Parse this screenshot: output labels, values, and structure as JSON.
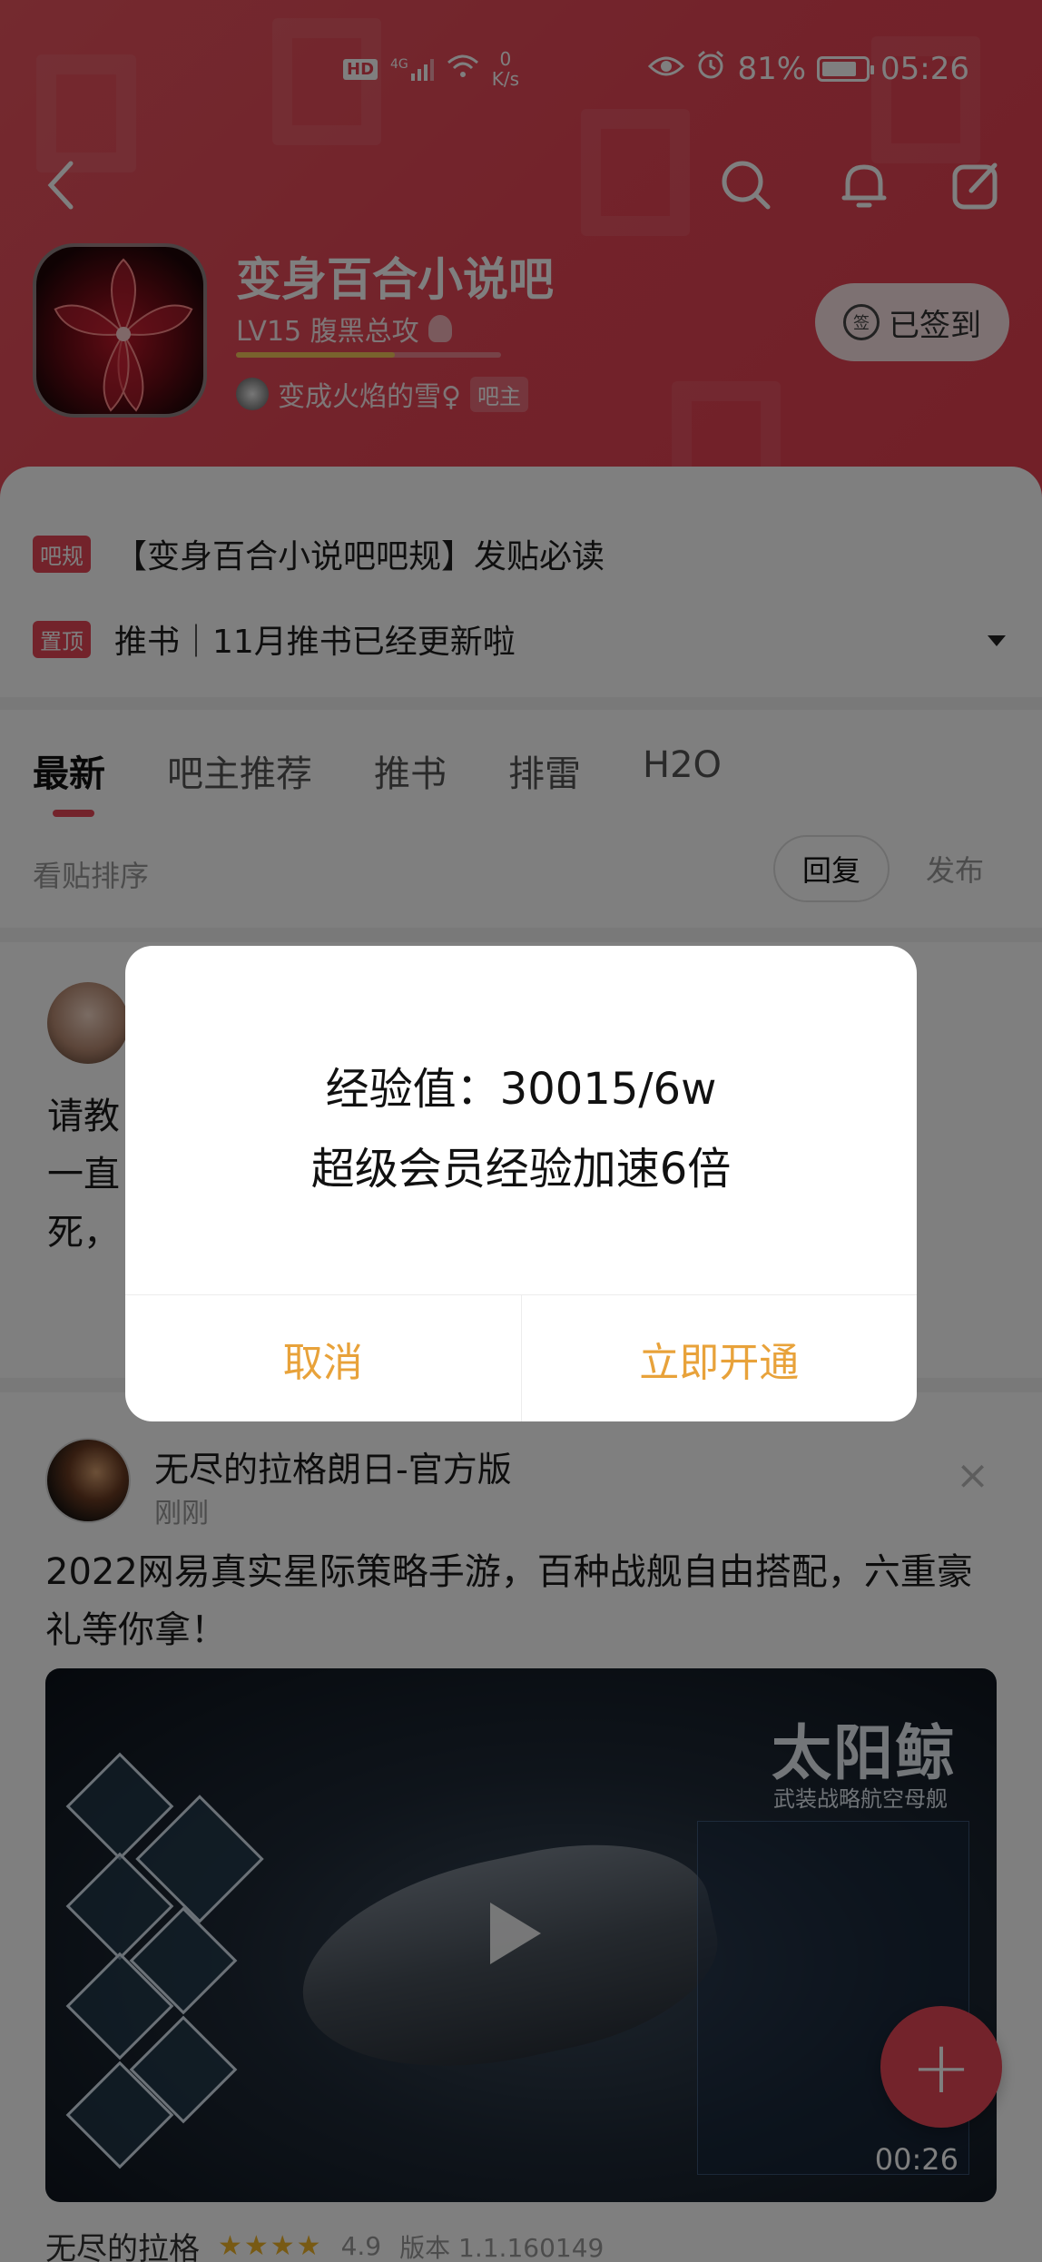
{
  "status_bar": {
    "hd": "HD",
    "network": "4G",
    "speed_value": "0",
    "speed_unit": "K/s",
    "battery": "81%",
    "battery_level": 0.81,
    "time": "05:26"
  },
  "forum": {
    "name": "变身百合小说吧",
    "level": "LV15 腹黑总攻",
    "level_progress": 0.6,
    "owner_name": "变成火焰的雪♀",
    "owner_badge": "吧主",
    "checkin_icon": "签",
    "checkin_label": "已签到"
  },
  "notices": [
    {
      "tag": "吧规",
      "text": "【变身百合小说吧吧规】发贴必读"
    },
    {
      "tag": "置顶",
      "text": "推书｜11月推书已经更新啦"
    }
  ],
  "tabs": [
    "最新",
    "吧主推荐",
    "推书",
    "排雷",
    "H2O"
  ],
  "sort": {
    "label": "看贴排序",
    "reply": "回复",
    "publish": "发布"
  },
  "post1": {
    "text_lines": [
      "请教",
      "一直",
      "死，"
    ]
  },
  "post2": {
    "author": "无尽的拉格朗日-官方版",
    "time": "刚刚",
    "close": "×",
    "text": "2022网易真实星际策略手游，百种战舰自由搭配，六重豪礼等你拿！",
    "video": {
      "title": "太阳鲸",
      "subtitle": "武装战略航空母舰",
      "duration": "00:26"
    },
    "bottom_name": "无尽的拉格",
    "stars": "★★★★",
    "rating": "4.9",
    "version": "版本 1.1.160149"
  },
  "fab": "+",
  "dialog": {
    "line1": "经验值：30015/6w",
    "line2": "超级会员经验加速6倍",
    "cancel": "取消",
    "confirm": "立即开通"
  },
  "colors": {
    "brand": "#e64656",
    "dialog_button": "#e8a23a"
  }
}
